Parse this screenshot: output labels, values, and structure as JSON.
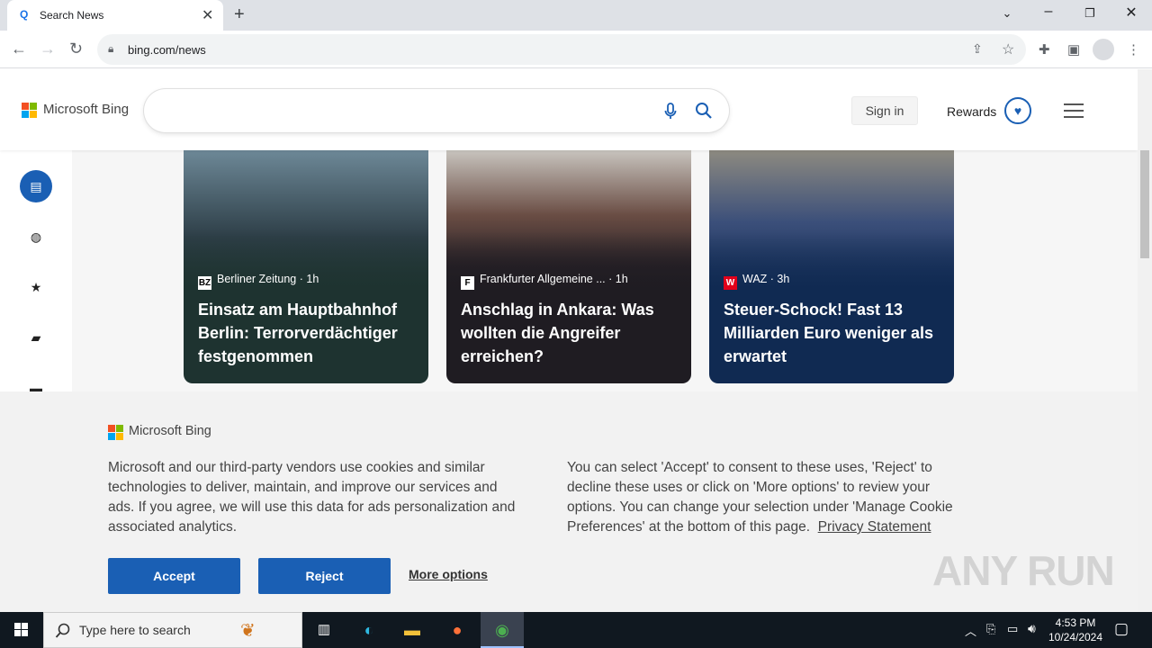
{
  "browser": {
    "tab_title": "Search News",
    "url": "bing.com/news"
  },
  "bing": {
    "brand": "Microsoft Bing",
    "signin_label": "Sign in",
    "rewards_label": "Rewards"
  },
  "cards": [
    {
      "source": "Berliner Zeitung",
      "time": "· 1h",
      "headline": "Einsatz am Hauptbahnhof Berlin: Terrorverdächtiger festgenommen",
      "logo_text": "BZ",
      "color": "#1e3330"
    },
    {
      "source": "Frankfurter Allgemeine ...",
      "time": "· 1h",
      "headline": "Anschlag in Ankara: Was wollten die Angreifer erreichen?",
      "logo_text": "F",
      "color": "#1f1c22"
    },
    {
      "source": "WAZ",
      "time": "· 3h",
      "headline": "Steuer-Schock! Fast 13 Milliarden Euro weniger als erwartet",
      "logo_text": "W",
      "color": "#102a52"
    }
  ],
  "cookie": {
    "brand": "Microsoft Bing",
    "text_left": "Microsoft and our third-party vendors use cookies and similar technologies to deliver, maintain, and improve our services and ads. If you agree, we will use this data for ads personalization and associated analytics.",
    "text_right": "You can select 'Accept' to consent to these uses, 'Reject' to decline these uses or click on 'More options' to review your options. You can change your selection under 'Manage Cookie Preferences' at the bottom of this page.",
    "privacy_link": "Privacy Statement",
    "accept_label": "Accept",
    "reject_label": "Reject",
    "more_options_label": "More options"
  },
  "watermark": "ANY RUN",
  "taskbar": {
    "search_placeholder": "Type here to search",
    "time": "4:53 PM",
    "date": "10/24/2024"
  },
  "colors": {
    "accent": "#1a5fb4"
  }
}
